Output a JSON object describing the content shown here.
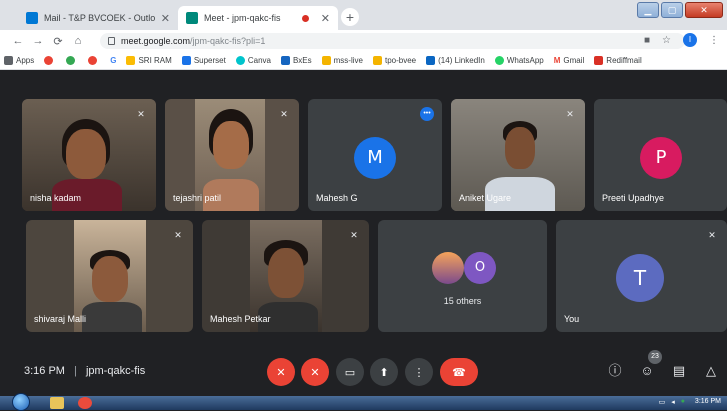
{
  "browser": {
    "tabs": [
      {
        "title": "Mail - T&P BVCOEK - Outlook",
        "active": false
      },
      {
        "title": "Meet - jpm-qakc-fis",
        "active": true
      }
    ],
    "new_tab": "+",
    "url_host": "meet.google.com",
    "url_path": "/jpm-qakc-fis?pli=1",
    "profile_initial": "I",
    "bookmarks": [
      {
        "label": "Apps",
        "color": "#5f6368"
      },
      {
        "label": "",
        "color": "#ea4335"
      },
      {
        "label": "",
        "color": "#34a853"
      },
      {
        "label": "",
        "color": "#ea4335"
      },
      {
        "label": "G",
        "color": "#4285f4"
      },
      {
        "label": "SRI RAM",
        "color": "#fbbc04"
      },
      {
        "label": "Superset",
        "color": "#1a73e8"
      },
      {
        "label": "Canva",
        "color": "#00c4cc"
      },
      {
        "label": "BxEs",
        "color": "#1565c0"
      },
      {
        "label": "mss-live",
        "color": "#f4b400"
      },
      {
        "label": "tpo-bvee",
        "color": "#f4b400"
      },
      {
        "label": "(14) LinkedIn",
        "color": "#0a66c2"
      },
      {
        "label": "WhatsApp",
        "color": "#25d366"
      },
      {
        "label": "Gmail",
        "color": "#ea4335"
      },
      {
        "label": "Rediffmail",
        "color": "#d93025"
      }
    ]
  },
  "participants": [
    {
      "name": "nisha kadam",
      "type": "video"
    },
    {
      "name": "tejashri patil",
      "type": "video"
    },
    {
      "name": "Mahesh G",
      "type": "avatar",
      "initial": "M",
      "color": "#1a73e8"
    },
    {
      "name": "Aniket Ugare",
      "type": "video"
    },
    {
      "name": "Preeti Upadhye",
      "type": "avatar",
      "initial": "P",
      "color": "#d81b60"
    },
    {
      "name": "shivaraj Malli",
      "type": "video"
    },
    {
      "name": "Mahesh Petkar",
      "type": "video"
    },
    {
      "name": "15 others",
      "type": "group",
      "initial": "O",
      "color": "#7e57c2"
    },
    {
      "name": "You",
      "type": "avatar",
      "initial": "T",
      "color": "#5c6bc0"
    }
  ],
  "meeting": {
    "time": "3:16 PM",
    "separator": "|",
    "code": "jpm-qakc-fis",
    "people_count": "23"
  },
  "taskbar": {
    "clock": "3:16 PM"
  }
}
